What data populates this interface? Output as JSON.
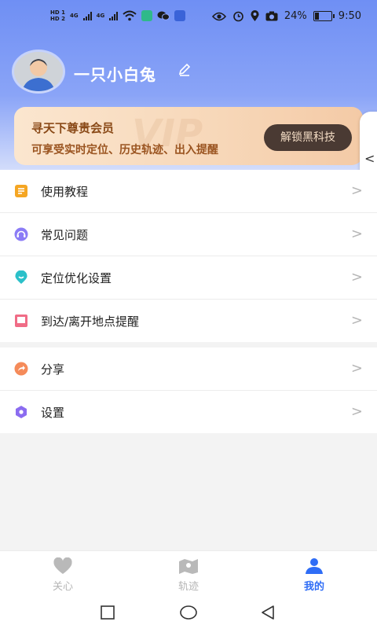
{
  "status_bar": {
    "sim1": "HD 1",
    "sim2": "HD 2",
    "net1": "4G",
    "net2": "4G",
    "battery_text": "24%",
    "battery_level": 0.24,
    "time": "9:50",
    "icons": [
      "wifi-icon",
      "app-icon-green",
      "wechat-icon",
      "app-icon-shield",
      "eye-icon",
      "alarm-icon",
      "location-icon",
      "camera-icon",
      "battery-icon"
    ]
  },
  "profile": {
    "name": "一只小白兔",
    "edit_icon": "pencil-icon"
  },
  "vip": {
    "title": "寻天下尊贵会员",
    "description": "可享受实时定位、历史轨迹、出入提醒",
    "watermark": "VIP",
    "button_label": "解锁黑科技"
  },
  "side_tab": {
    "arrow": "<"
  },
  "menu_group_1": [
    {
      "label": "使用教程",
      "icon": "tutorial-icon",
      "color": "#f5a623"
    },
    {
      "label": "常见问题",
      "icon": "headset-icon",
      "color": "#8b7cf6"
    },
    {
      "label": "定位优化设置",
      "icon": "location-pin-icon",
      "color": "#2bc0c9"
    },
    {
      "label": "到达/离开地点提醒",
      "icon": "arrival-icon",
      "color": "#f06c86"
    }
  ],
  "menu_group_2": [
    {
      "label": "分享",
      "icon": "share-icon",
      "color": "#f58b5a"
    },
    {
      "label": "设置",
      "icon": "settings-icon",
      "color": "#8b6cf0"
    }
  ],
  "chevron": ">",
  "bottom_nav": [
    {
      "label": "关心",
      "icon": "heart-icon",
      "active": false
    },
    {
      "label": "轨迹",
      "icon": "map-icon",
      "active": false
    },
    {
      "label": "我的",
      "icon": "person-icon",
      "active": true
    }
  ],
  "colors": {
    "accent": "#2f6df6",
    "header_gradient_top": "#6f8ff4",
    "vip_button_bg": "#4a3a33"
  }
}
